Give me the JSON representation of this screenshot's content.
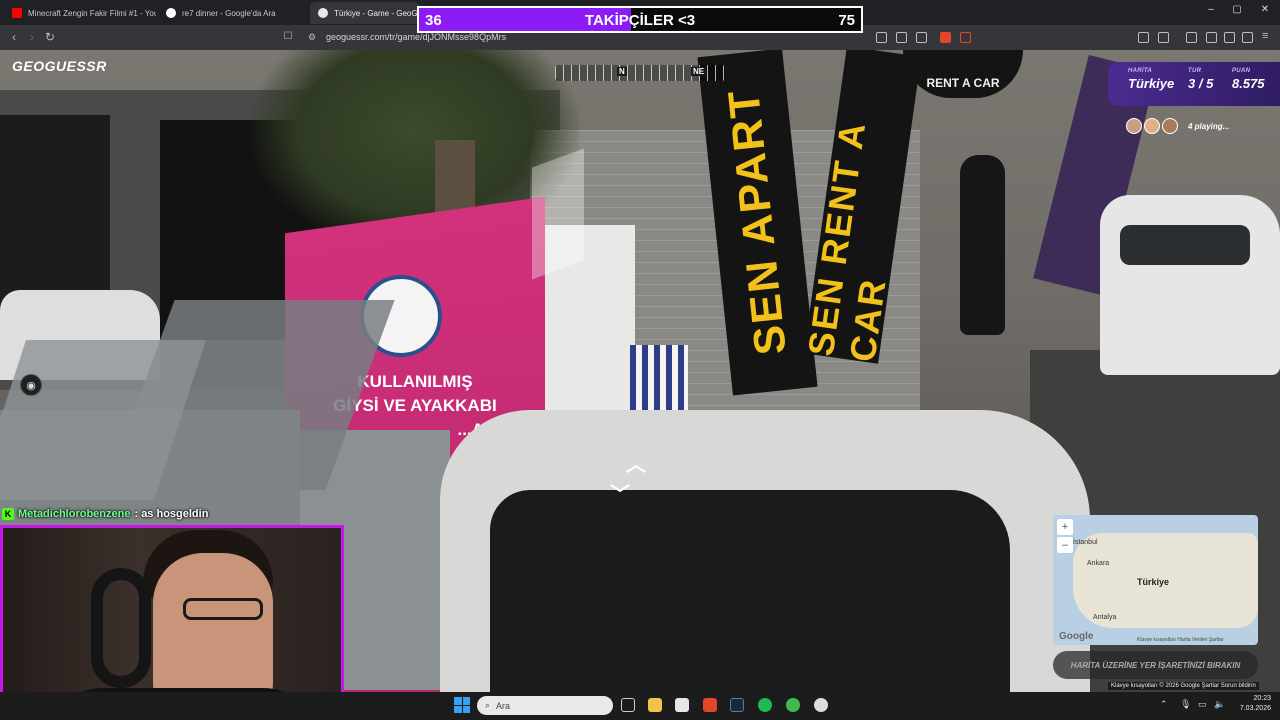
{
  "browser": {
    "tabs": [
      {
        "title": "Minecraft Zengin Fakir Filmi #1 - You",
        "favicon_color": "#ff0000"
      },
      {
        "title": "re7 dinner - Google'da Ara",
        "favicon_color": "#ffffff"
      },
      {
        "title": "Türkiye - Game - GeoG",
        "favicon_color": "#e9e9e9"
      }
    ],
    "url": "geoguessr.com/tr/game/djJONMsse98QpMrs",
    "window_controls": [
      "–",
      "▢",
      "✕"
    ]
  },
  "game": {
    "logo": "GEOGUESSR",
    "compass": {
      "north": "N",
      "northeast": "NE"
    },
    "hud": {
      "map_label": "HARİTA",
      "map_value": "Türkiye",
      "round_label": "TUR",
      "round_value": "3 / 5",
      "score_label": "PUAN",
      "score_value": "8.575"
    },
    "players_text": "4 playing...",
    "place_hint": "HARİTA ÜZERİNE YER İŞARETİNİZİ BIRAKIN",
    "minimap": {
      "labels": {
        "istanbul": "İstanbul",
        "ankara": "Ankara",
        "turkiye": "Türkiye",
        "antalya": "Antalya"
      },
      "google": "Google",
      "footer": "Klavye kısayolları   Harita Verileri   Şartlar",
      "zoom_in": "+",
      "zoom_out": "–"
    },
    "legal": "Klavye kısayolları   © 2026 Google   Şartlar   Sorun bildirin"
  },
  "scene": {
    "pink_box_lines": [
      "KULLANILMIŞ",
      "GİYSİ VE AYAKKABI",
      "...ASI"
    ],
    "banner_left": "SEN APART",
    "banner_right": "SEN RENT A CAR",
    "sign": "RENT A CAR"
  },
  "overlay": {
    "goal_title": "TAKİPÇİLER <3",
    "goal_current": "36",
    "goal_target": "75",
    "goal_color": "#8c1bf5",
    "goal_progress": 0.48
  },
  "chat": {
    "platform_icon": "K",
    "username": "Metadichlorobenzene",
    "message": ": as hosgeldin"
  },
  "taskbar": {
    "search_placeholder": "Ara",
    "time": "20:23",
    "date": "7.03.2026"
  },
  "colors": {
    "accent_purple": "#8c1bf5",
    "cam_border": "#c617e8",
    "kick_green": "#53fc18"
  }
}
